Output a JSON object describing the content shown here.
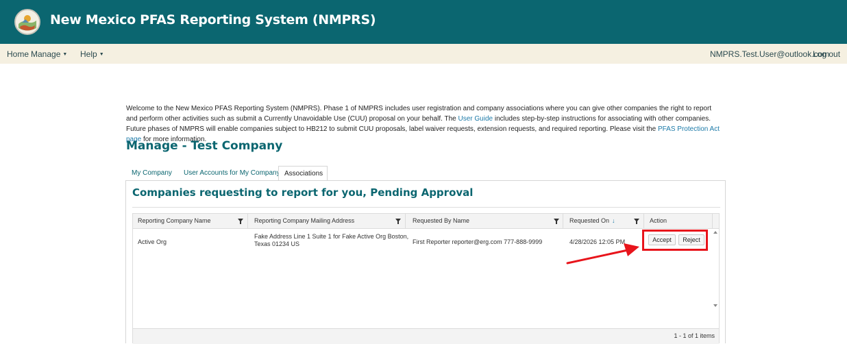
{
  "header": {
    "title": "New Mexico PFAS Reporting System (NMPRS)",
    "logo_icon": "new-mexico-seal-logo",
    "background_color": "#0b6670"
  },
  "nav": {
    "items": [
      {
        "label": "Home",
        "has_caret": false
      },
      {
        "label": "Manage",
        "has_caret": true
      },
      {
        "label": "Help",
        "has_caret": true
      }
    ],
    "user_email": "NMPRS.Test.User@outlook.com",
    "logout_label": "Log out"
  },
  "intro": {
    "text_1": "Welcome to the New Mexico PFAS Reporting System (NMPRS). Phase 1 of NMPRS includes user registration and company associations where you can give other companies the right to report and perform other activities such as submit a Currently Unavoidable Use (CUU) proposal on your behalf. The ",
    "link_1": "User Guide",
    "text_2": " includes step-by-step instructions for associating with other companies. Future phases of NMPRS will enable companies subject to HB212 to submit CUU proposals, label waiver requests, extension requests, and required reporting. Please visit the ",
    "link_2": "PFAS Protection Act page",
    "text_3": " for more information."
  },
  "page": {
    "title": "Manage - Test Company"
  },
  "tabs": [
    {
      "label": "My Company",
      "active": false
    },
    {
      "label": "User Accounts for My Company",
      "active": false
    },
    {
      "label": "Associations",
      "active": true
    }
  ],
  "section": {
    "title": "Companies requesting to report for you, Pending Approval"
  },
  "grid": {
    "columns": [
      {
        "label": "Reporting Company Name",
        "filter": true
      },
      {
        "label": "Reporting Company Mailing Address",
        "filter": true
      },
      {
        "label": "Requested By Name",
        "filter": true
      },
      {
        "label": "Requested On",
        "filter": true,
        "sort": "desc"
      },
      {
        "label": "Action",
        "filter": false
      }
    ],
    "rows": [
      {
        "company_name": "Active Org",
        "address_line_1": "Fake Address Line 1 Suite 1 for Fake Active Org Boston,",
        "address_line_2": "Texas 01234 US",
        "requested_by": "First Reporter reporter@erg.com 777-888-9999",
        "requested_on": "4/28/2026 12:05 PM",
        "actions": [
          "Accept",
          "Reject"
        ]
      }
    ],
    "pager_info": "1 - 1 of 1 items"
  },
  "annotation": {
    "highlight_color": "#e8141b",
    "arrow_icon": "red-arrow-pointer"
  }
}
